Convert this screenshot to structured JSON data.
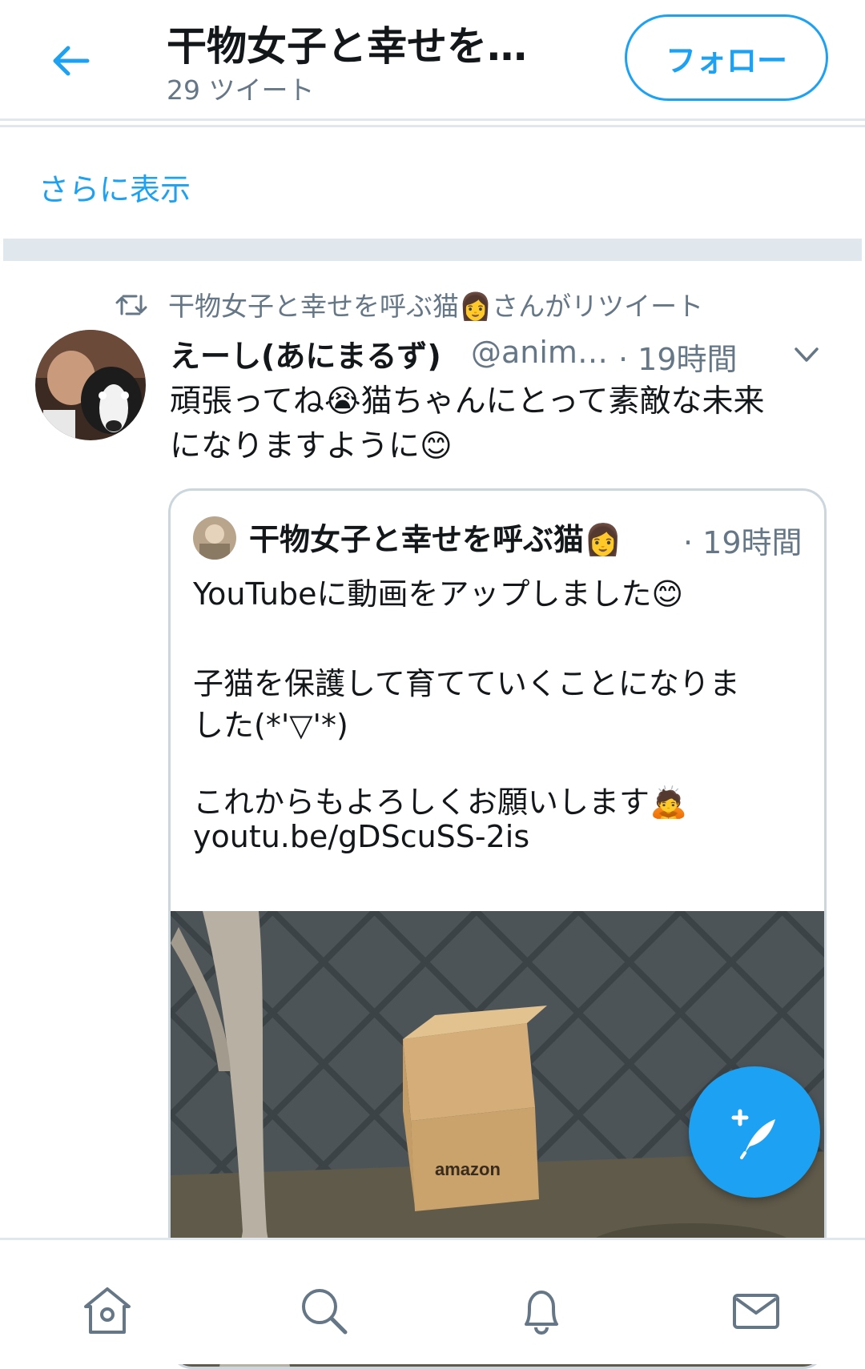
{
  "header": {
    "title": "干物女子と幸せを…",
    "tweet_count": "29 ツイート",
    "follow_label": "フォロー"
  },
  "show_more": "さらに表示",
  "retweet": {
    "text": "干物女子と幸せを呼ぶ猫👩さんがリツイート"
  },
  "tweet": {
    "name": "えーし(あにまるず)",
    "handle": "@anim…",
    "time": "· 19時間",
    "text_line1": "頑張ってね😭猫ちゃんにとって素敵な未来",
    "text_line2": "になりますように😊"
  },
  "quote": {
    "name": "干物女子と幸せを呼ぶ猫👩",
    "time": "· 19時間",
    "line1": "YouTubeに動画をアップしました😊",
    "line2": "子猫を保護して育てていくことになりま",
    "line3": "した(*'▽'*)",
    "line4": "これからもよろしくお願いします🙇",
    "link": "youtu.be/gDScuSS-2is",
    "box_label": "amazon"
  },
  "colors": {
    "accent": "#1da1f2",
    "muted": "#657786",
    "border": "#e1e8ed"
  },
  "nav": {
    "items": [
      "home-icon",
      "search-icon",
      "bell-icon",
      "mail-icon"
    ]
  }
}
